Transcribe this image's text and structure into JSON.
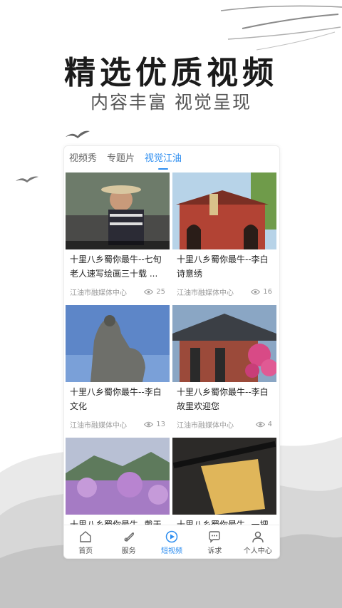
{
  "promo": {
    "headline": "精选优质视频",
    "subheadline": "内容丰富 视觉呈现"
  },
  "tabs": [
    {
      "label": "视频秀",
      "active": false
    },
    {
      "label": "专题片",
      "active": false
    },
    {
      "label": "视觉江油",
      "active": true
    }
  ],
  "videos": [
    {
      "title": "十里八乡蜀你最牛--七旬老人速写绘画三十载 ...",
      "source": "江油市融媒体中心",
      "views": "25",
      "thumb": "painter-icon"
    },
    {
      "title": "十里八乡蜀你最牛--李白诗意绣",
      "source": "江油市融媒体中心",
      "views": "16",
      "thumb": "temple-gate-icon"
    },
    {
      "title": "十里八乡蜀你最牛--李白文化",
      "source": "江油市融媒体中心",
      "views": "13",
      "thumb": "statue-icon"
    },
    {
      "title": "十里八乡蜀你最牛--李白故里欢迎您",
      "source": "江油市融媒体中心",
      "views": "4",
      "thumb": "pavilion-icon"
    },
    {
      "title": "十里八乡蜀你最牛--戴天",
      "source": "",
      "views": "",
      "thumb": "blossom-mountain-icon"
    },
    {
      "title": "十里八乡蜀你最牛--一把",
      "source": "",
      "views": "",
      "thumb": "craft-icon"
    }
  ],
  "nav": [
    {
      "label": "首页",
      "icon": "home-icon",
      "active": false
    },
    {
      "label": "服务",
      "icon": "service-icon",
      "active": false
    },
    {
      "label": "短视频",
      "icon": "play-icon",
      "active": true
    },
    {
      "label": "诉求",
      "icon": "chat-icon",
      "active": false
    },
    {
      "label": "个人中心",
      "icon": "user-icon",
      "active": false
    }
  ],
  "colors": {
    "accent": "#2e8ef0",
    "text": "#222222",
    "muted": "#9a9a9a"
  }
}
